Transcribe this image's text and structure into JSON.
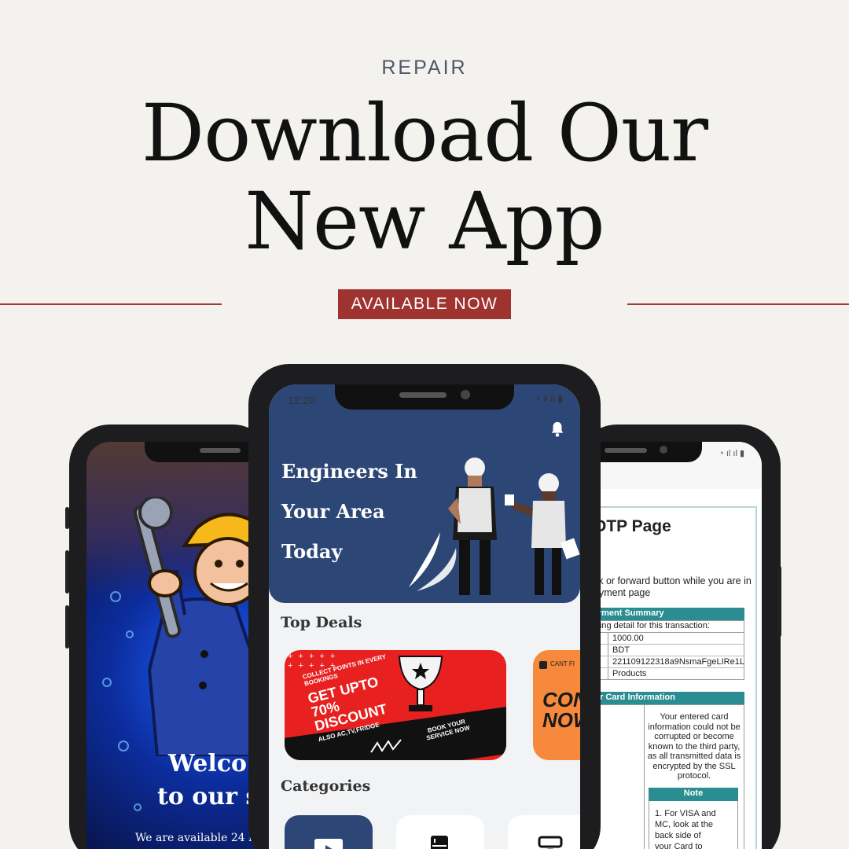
{
  "header": {
    "eyebrow": "REPAIR",
    "title_line1": "Download Our",
    "title_line2": "New App",
    "badge": "AVAILABLE NOW"
  },
  "left_phone": {
    "welcome_line1": "Welco",
    "welcome_line2": "to our st",
    "subtext": "We are available 24 h"
  },
  "center_phone": {
    "status_time": "12:20",
    "hero_line1": "Engineers In",
    "hero_line2": "Your Area",
    "hero_line3": "Today",
    "top_deals_title": "Top Deals",
    "deal1": {
      "collect": "COLLECT POINTS IN EVERY BOOKINGS",
      "headline1": "GET UPTO",
      "headline2": "70%",
      "headline3": "DISCOUNT",
      "also": "ALSO AC,TV,FRIDGE",
      "book": "BOOK YOUR SERVICE NOW"
    },
    "deal2": {
      "tag": "CANT FI",
      "big1": "CON",
      "big2": "NOW"
    },
    "categories_title": "Categories"
  },
  "right_phone": {
    "title": "OTP Page",
    "warning_line1": "ck or forward button while you are in",
    "warning_line2": "ayment page",
    "summary_head": "yment Summary",
    "summary_sub": "wing detail for this transaction:",
    "amount": "1000.00",
    "currency": "BDT",
    "tran_id": "221109122318a9NsmaFgeLIRe1L",
    "product": "Products",
    "card_head": "r Card Information",
    "card_text": [
      "Your entered card",
      "information could not be",
      "corrupted or become",
      "known to the third party,",
      "as all transmitted data is",
      "encrypted by the SSL",
      "protocol."
    ],
    "note_head": "Note",
    "note_text": [
      "1. For VISA and",
      "MC, look at the",
      "back side of",
      "your Card to"
    ]
  },
  "colors": {
    "accent_red": "#9e3330",
    "hero_blue": "#2c4676",
    "deal_red": "#e8201f",
    "teal": "#2a8d91"
  }
}
